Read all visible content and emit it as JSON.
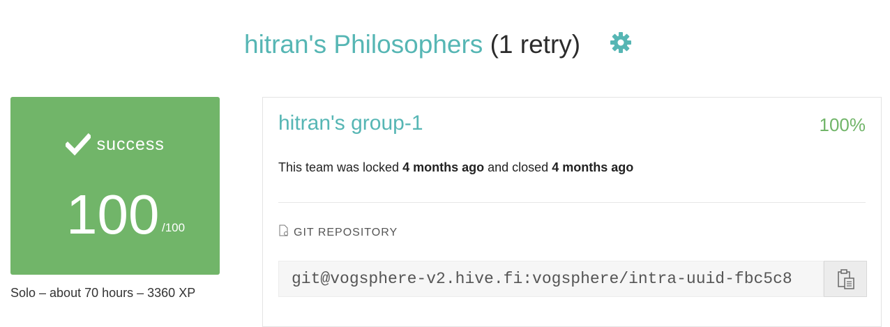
{
  "header": {
    "project_name": "hitran's Philosophers",
    "retry_info": "(1 retry)",
    "settings_icon": "gear-icon"
  },
  "result": {
    "status_icon": "check-icon",
    "status": "success",
    "score": "100",
    "max_score": "/100",
    "summary": "Solo – about 70 hours – 3360 XP"
  },
  "team": {
    "name": "hitran's group-1",
    "percent": "100%",
    "status_prefix": "This team was locked",
    "locked_ago": "4 months ago",
    "status_middle": "and closed",
    "closed_ago": "4 months ago",
    "git_label": "GIT REPOSITORY",
    "repo_url": "git@vogsphere-v2.hive.fi:vogsphere/intra-uuid-fbc5c8",
    "copy_icon": "clipboard-icon"
  },
  "colors": {
    "accent": "#56b6b4",
    "success": "#71b569"
  }
}
